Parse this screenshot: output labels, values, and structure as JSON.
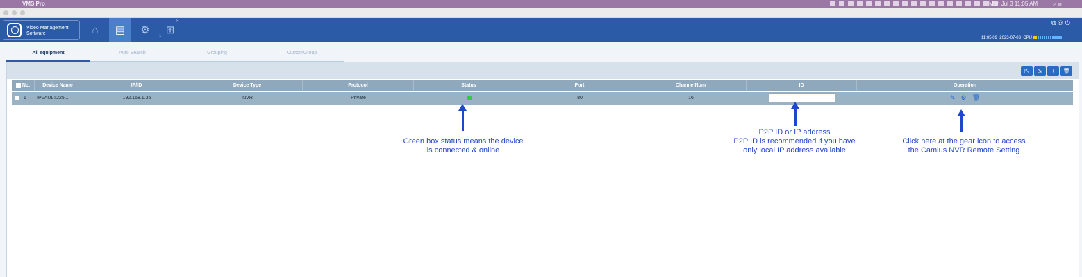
{
  "menubar": {
    "app": "VMS Pro",
    "clock": "Mon Jul 3  11:05 AM"
  },
  "app": {
    "logo_line1": "Video Management",
    "logo_line2": "Software",
    "nav": [
      {
        "name": "home-icon",
        "active": false
      },
      {
        "name": "device-list-icon",
        "active": true
      },
      {
        "name": "settings-icon",
        "active": false
      },
      {
        "name": "layout-icon",
        "active": false,
        "sub": "1"
      }
    ],
    "time": "11:05:09",
    "date": "2023-07-03",
    "cpu_label": "CPU"
  },
  "tabs": [
    {
      "label": "All equipment",
      "active": true
    },
    {
      "label": "Auto Search",
      "active": false
    },
    {
      "label": "Grouping",
      "active": false
    },
    {
      "label": "CustomGroup",
      "active": false
    }
  ],
  "toolbar": [
    "export-icon",
    "import-icon",
    "add-icon",
    "delete-icon"
  ],
  "table": {
    "headers": [
      "No.",
      "Device Name",
      "IP/ID",
      "Device Type",
      "Protocol",
      "Status",
      "Port",
      "ChannelNum",
      "ID",
      "Operation"
    ],
    "rows": [
      {
        "no": "1",
        "name": "IPVAULT225...",
        "ip": "192.168.1.36",
        "type": "NVR",
        "protocol": "Private",
        "status": "online",
        "port": "80",
        "channels": "16",
        "id": ""
      }
    ]
  },
  "annotations": {
    "status_note": "Green box status means the device\nis connected & online",
    "id_note": "P2P ID or IP address\nP2P ID is recommended if you have\nonly local IP address available",
    "operation_note": "Click here at the gear icon to access\nthe Camius NVR Remote Setting"
  },
  "colors": {
    "header_bg": "#2b5ba7",
    "status_online": "#2ecc40",
    "annotation": "#1f47c9"
  }
}
